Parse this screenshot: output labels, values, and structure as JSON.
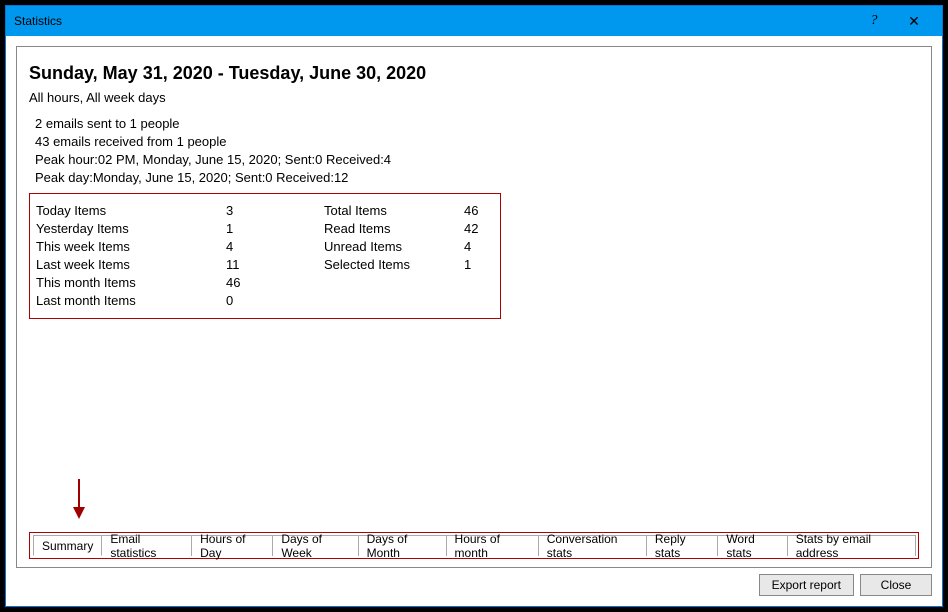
{
  "titlebar": {
    "title": "Statistics",
    "help": "?",
    "close": "✕"
  },
  "heading": "Sunday, May 31, 2020 - Tuesday, June 30, 2020",
  "subheading": "All hours, All week days",
  "info": {
    "line1": "2 emails sent to 1 people",
    "line2": "43 emails received from 1 people",
    "line3": "Peak hour:02 PM, Monday, June 15, 2020; Sent:0 Received:4",
    "line4": "Peak day:Monday, June 15, 2020; Sent:0 Received:12"
  },
  "stats": {
    "left": [
      {
        "label": "Today Items",
        "value": "3"
      },
      {
        "label": "Yesterday Items",
        "value": "1"
      },
      {
        "label": "This week Items",
        "value": "4"
      },
      {
        "label": "Last week Items",
        "value": "11"
      },
      {
        "label": "This month Items",
        "value": "46"
      },
      {
        "label": "Last month Items",
        "value": "0"
      }
    ],
    "right": [
      {
        "label": "Total Items",
        "value": "46"
      },
      {
        "label": "Read Items",
        "value": "42"
      },
      {
        "label": "Unread Items",
        "value": "4"
      },
      {
        "label": "Selected Items",
        "value": "1"
      }
    ]
  },
  "tabs": [
    "Summary",
    "Email statistics",
    "Hours of Day",
    "Days of Week",
    "Days of Month",
    "Hours of month",
    "Conversation stats",
    "Reply stats",
    "Word stats",
    "Stats by email address"
  ],
  "buttons": {
    "export": "Export report",
    "close": "Close"
  }
}
